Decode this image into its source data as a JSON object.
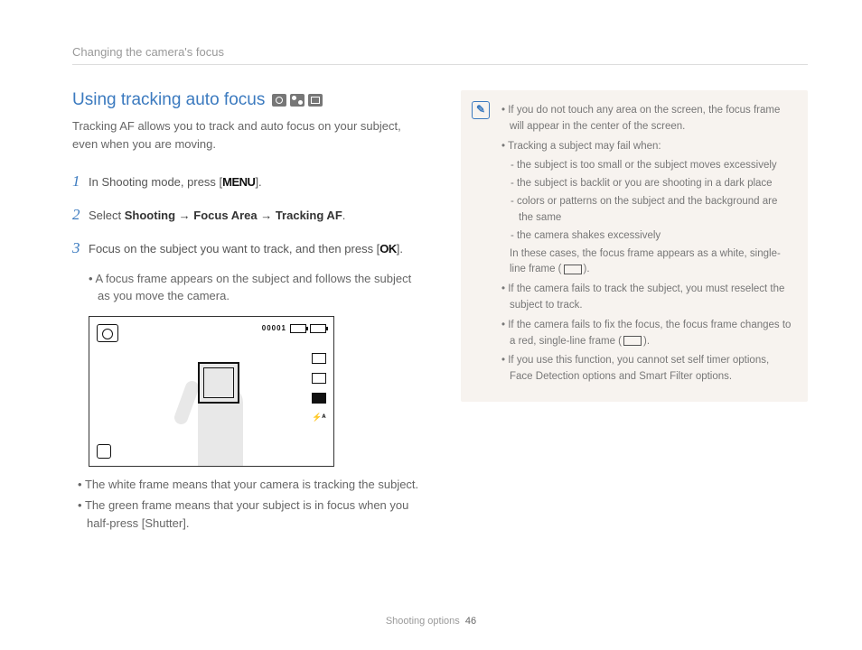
{
  "header": {
    "breadcrumb": "Changing the camera's focus"
  },
  "title": "Using tracking auto focus",
  "intro": "Tracking AF allows you to track and auto focus on your subject, even when you are moving.",
  "steps": {
    "s1_pre": "In Shooting mode, press [",
    "s1_btn": "MENU",
    "s1_post": "].",
    "s2_pre": "Select ",
    "s2_path": "Shooting → Focus Area → Tracking AF",
    "s2_post": ".",
    "s3_pre": "Focus on the subject you want to track, and then press [",
    "s3_btn": "OK",
    "s3_post": "].",
    "s3_sub": "A focus frame appears on the subject and follows the subject as you move the camera."
  },
  "screenshot": {
    "counter": "00001"
  },
  "after_bullets": {
    "b1_pre": "The white frame means that your camera is tracking the subject.",
    "b2_pre": "The green frame means that your subject is in focus when you half-press [",
    "b2_bold": "Shutter",
    "b2_post": "]."
  },
  "note": {
    "n1": "If you do not touch any area on the screen, the focus frame will appear in the center of the screen.",
    "n2": "Tracking a subject may fail when:",
    "n2a": "the subject is too small or the subject moves excessively",
    "n2b": "the subject is backlit or you are shooting in a dark place",
    "n2c": "colors or patterns on the subject and the background are the same",
    "n2d": "the camera shakes excessively",
    "n2_trail_pre": "In these cases, the focus frame appears as a white, single-line frame (",
    "n2_trail_post": ").",
    "n3": "If the camera fails to track the subject, you must reselect the subject to track.",
    "n4_pre": "If the camera fails to fix the focus, the focus frame changes to a red, single-line frame (",
    "n4_post": ").",
    "n5": "If you use this function, you cannot set self timer options, Face Detection options and Smart Filter options."
  },
  "footer": {
    "section": "Shooting options",
    "page": "46"
  }
}
